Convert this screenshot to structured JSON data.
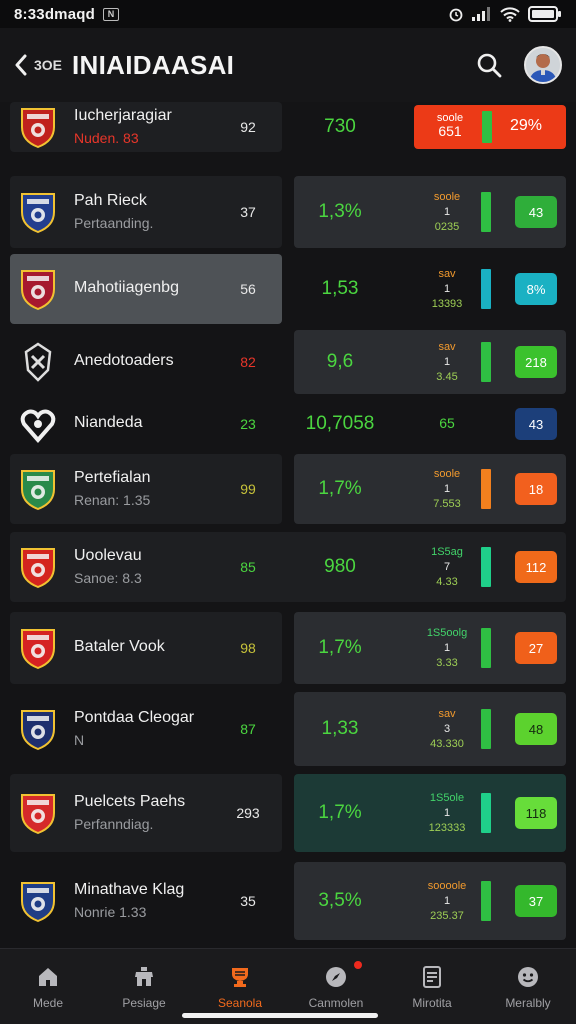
{
  "status_bar": {
    "time": "8:33dmaqd",
    "box_glyph": "N",
    "icons": [
      "alarm-icon",
      "signal-icon",
      "wifi-icon",
      "battery-icon"
    ]
  },
  "header": {
    "back_label": "3OE",
    "title": "INIAIDAASAI",
    "search_icon": "search-icon",
    "avatar_icon": "avatar"
  },
  "rows": [
    {
      "name": "Iucherjaragiar",
      "sub": "Nuden. 83",
      "n1": "92",
      "n2": "730",
      "stack": [
        "soole",
        "651",
        ""
      ],
      "value": "29%",
      "accent": "#ec3a17",
      "crest": "#c0211d"
    },
    {
      "name": "Pah Rieck",
      "sub": "Pertaanding.",
      "n1": "37",
      "n2": "1,3%",
      "stack": [
        "soole",
        "1",
        "0235"
      ],
      "value": "43",
      "accent": "#2fae3a",
      "crest": "#223e8f"
    },
    {
      "name": "Mahotiiagenbg",
      "sub": "",
      "n1": "56",
      "n2": "1,53",
      "stack": [
        "sav",
        "1",
        "13393"
      ],
      "value": "8%",
      "accent": "#1ab1c3",
      "crest": "#a6192e"
    },
    {
      "name": "Anedotoaders",
      "sub": "",
      "n1": "82",
      "n2": "9,6",
      "stack": [
        "sav",
        "1",
        "3.45"
      ],
      "value": "218",
      "accent": "#3bc22d",
      "crest": "#ececec"
    },
    {
      "name": "Niandeda",
      "sub": "",
      "n1": "23",
      "n2": "10,7058",
      "stack": [
        "65"
      ],
      "value": "43",
      "accent": "#1c3f7a",
      "crest": "#f2f2f2"
    },
    {
      "name": "Pertefialan",
      "sub": "Renan: 1.35",
      "n1": "99",
      "n2": "1,7%",
      "stack": [
        "soole",
        "1",
        "7.553"
      ],
      "value": "18",
      "accent": "#f2601e",
      "crest": "#2a8a4a"
    },
    {
      "name": "Uoolevau",
      "sub": "Sanoe: 8.3",
      "n1": "85",
      "n2": "980",
      "stack": [
        "1S5ag",
        "7",
        "4.33"
      ],
      "value": "112",
      "accent": "#f06a1a",
      "crest": "#d4241e"
    },
    {
      "name": "Bataler Vook",
      "sub": "",
      "n1": "98",
      "n2": "1,7%",
      "stack": [
        "1S5oolg",
        "1",
        "3.33"
      ],
      "value": "27",
      "accent": "#f0601a",
      "crest": "#d52222"
    },
    {
      "name": "Pontdaa Cleogar",
      "sub": "N",
      "n1": "87",
      "n2": "1,33",
      "stack": [
        "sav",
        "3",
        "43.330"
      ],
      "value": "48",
      "accent": "#5cd22e",
      "crest": "#1e2f6e"
    },
    {
      "name": "Puelcets Paehs",
      "sub": "Perfanndiag.",
      "n1": "293",
      "n2": "1,7%",
      "stack": [
        "1S5ole",
        "1",
        "123333"
      ],
      "value": "118",
      "accent": "#67dd3a",
      "crest": "#d52a2a"
    },
    {
      "name": "Minathave Klag",
      "sub": "Nonrie 1.33",
      "n1": "35",
      "n2": "3,5%",
      "stack": [
        "soooole",
        "1",
        "235.37"
      ],
      "value": "37",
      "accent": "#34b82c",
      "crest": "#1f3d86"
    }
  ],
  "bottom_nav": [
    {
      "label": "Mede",
      "icon": "home-icon"
    },
    {
      "label": "Pesiage",
      "icon": "store-icon"
    },
    {
      "label": "Seanola",
      "icon": "trophy-icon",
      "active": true
    },
    {
      "label": "Canmolen",
      "icon": "compass-icon",
      "badge": true
    },
    {
      "label": "Mirotita",
      "icon": "document-icon"
    },
    {
      "label": "Meralbly",
      "icon": "face-icon"
    }
  ],
  "colors": {
    "background": "#141416",
    "row": "#1e1f22",
    "panel": "#2b2d31",
    "green": "#4bd640",
    "orange": "#f26a1d",
    "red": "#ec3a17"
  }
}
